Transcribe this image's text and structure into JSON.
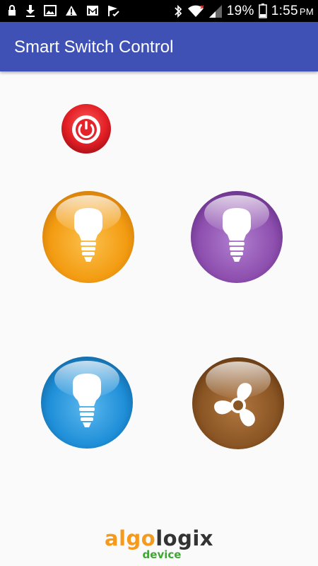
{
  "status_bar": {
    "battery_percent": "19%",
    "time": "1:55",
    "ampm": "PM",
    "icons_left": [
      "lock-icon",
      "download-icon",
      "image-icon",
      "warning-icon",
      "gmail-icon",
      "flag-check-icon"
    ],
    "icons_right": [
      "bluetooth-icon",
      "wifi-icon",
      "signal-icon",
      "battery-icon"
    ]
  },
  "app_bar": {
    "title": "Smart Switch Control",
    "color": "#3f51b5"
  },
  "controls": {
    "power": {
      "icon": "power-icon",
      "color": "#e8202a"
    },
    "switches": [
      {
        "icon": "bulb-icon",
        "color": "#f7a21b"
      },
      {
        "icon": "bulb-icon",
        "color": "#8e4fae"
      },
      {
        "icon": "bulb-icon",
        "color": "#1f8fd8"
      },
      {
        "icon": "fan-icon",
        "color": "#8a5524"
      }
    ]
  },
  "logo": {
    "part1": "algo",
    "part2": "logix",
    "sub": "device"
  }
}
